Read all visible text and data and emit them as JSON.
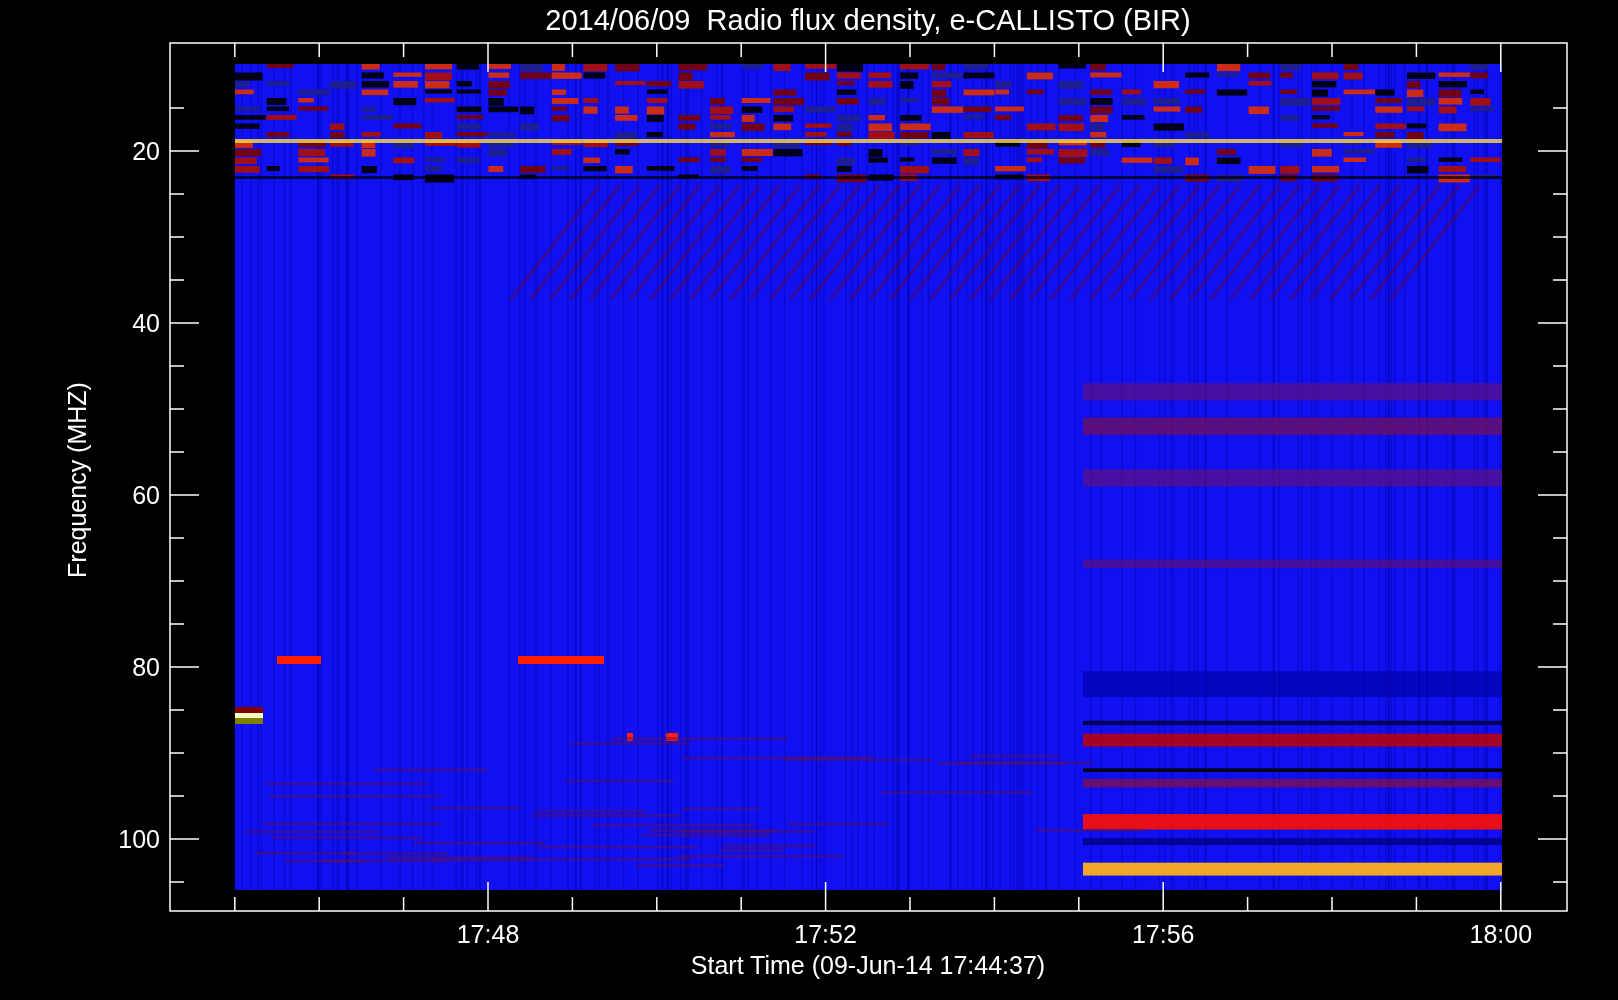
{
  "title": "2014/06/09  Radio flux density, e-CALLISTO (BIR)",
  "y_axis": {
    "label": "Frequency (MHZ)",
    "tick_labels": [
      "20",
      "40",
      "60",
      "80",
      "100"
    ]
  },
  "x_axis": {
    "label": "Start Time (09-Jun-14 17:44:37)",
    "tick_labels": [
      "17:48",
      "17:52",
      "17:56",
      "18:00"
    ]
  }
}
